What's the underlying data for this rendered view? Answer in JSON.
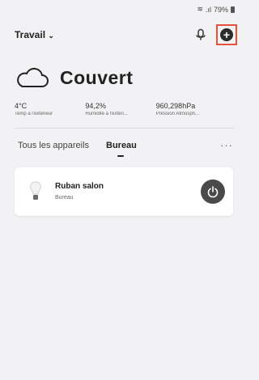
{
  "status_bar": {
    "battery": "79%",
    "signal_icon": "signal-icon",
    "wifi_icon": "wifi-icon"
  },
  "header": {
    "home_title": "Travail",
    "dropdown_icon": "chevron-down-icon",
    "mic_icon": "mic-icon",
    "add_icon": "plus-circle-icon",
    "highlight_color": "#e5533a"
  },
  "weather": {
    "icon": "cloud-icon",
    "condition": "Couvert",
    "metrics": [
      {
        "value": "4°C",
        "label": "Temp à l'extérieur"
      },
      {
        "value": "94,2%",
        "label": "Humidité à l'extéri..."
      },
      {
        "value": "960,298hPa",
        "label": "Pression Atmosph..."
      }
    ]
  },
  "tabs": {
    "items": [
      "Tous les appareils",
      "Bureau"
    ],
    "selected": "Bureau",
    "more_icon": "more-horizontal-icon"
  },
  "devices": [
    {
      "name": "Ruban salon",
      "room": "Bureau",
      "icon": "bulb-icon",
      "power_icon": "power-icon"
    }
  ]
}
